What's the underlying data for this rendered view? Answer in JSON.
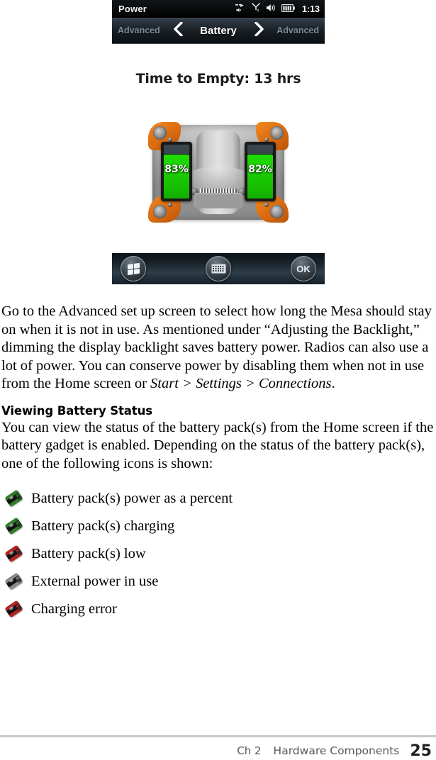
{
  "device_screenshot": {
    "status_bar": {
      "title": "Power",
      "icons": [
        "connectivity-icon",
        "signal-no-service-icon",
        "volume-icon",
        "battery-icon"
      ],
      "clock": "1:13"
    },
    "nav_bar": {
      "left_label": "Advanced",
      "left_chevron": "❮",
      "center_title": "Battery",
      "right_chevron": "❯",
      "right_label": "Advanced"
    },
    "screen": {
      "time_to_empty": "Time to Empty: 13 hrs",
      "battery_cells": [
        {
          "label": "83%",
          "percent": 83
        },
        {
          "label": "82%",
          "percent": 82
        }
      ]
    },
    "soft_bar": {
      "start_button": "start-windows-flag-icon",
      "keyboard_button": "keyboard-icon",
      "ok_button": "OK"
    }
  },
  "document": {
    "paragraph_1_parts": {
      "before": "Go to the Advanced set up screen to select how long the Mesa should stay on when it is not in use. As mentioned under “Adjusting the Backlight,” dimming the display backlight saves battery power. Radios can also use a lot of power. You can conserve power by disabling them when not in use from the Home screen or ",
      "italic": "Start > Settings > Connections",
      "after": "."
    },
    "heading": "Viewing Battery Status",
    "paragraph_2": "You can view the status of the battery pack(s) from the Home screen if the battery gadget is enabled. Depending on the status of the battery pack(s), one of the following icons is shown:",
    "icon_list": [
      {
        "icon": "battery-green-icon",
        "color_1": "#2f7d2a",
        "color_2": "#2f7d2a",
        "label": "Battery pack(s) power as a percent"
      },
      {
        "icon": "battery-charging-icon",
        "color_1": "#2f7d2a",
        "color_2": "#2f7d2a",
        "label": "Battery pack(s) charging"
      },
      {
        "icon": "battery-low-red-icon",
        "color_1": "#b02424",
        "color_2": "#b02424",
        "label": "Battery pack(s) low"
      },
      {
        "icon": "battery-external-power-icon",
        "color_1": "#8a8a8a",
        "color_2": "#8a8a8a",
        "label": "External power in use"
      },
      {
        "icon": "battery-charging-error-icon",
        "color_1": "#b02424",
        "color_2": "#b02424",
        "label": "Charging error"
      }
    ]
  },
  "footer": {
    "chapter": "Ch 2",
    "section": "Hardware Components",
    "page_number": "25"
  }
}
